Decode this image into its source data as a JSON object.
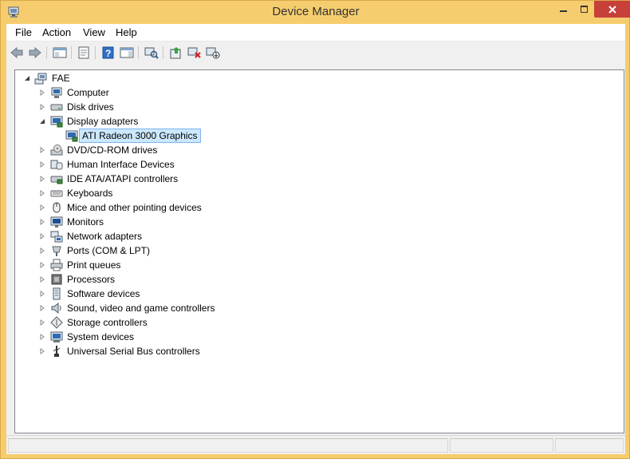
{
  "window": {
    "title": "Device Manager",
    "colors": {
      "frame": "#f6cd6e",
      "close": "#c7403a",
      "selection": "#cce8ff"
    }
  },
  "menu": [
    "File",
    "Action",
    "View",
    "Help"
  ],
  "toolbar": {
    "buttons": [
      "back-icon",
      "forward-icon",
      "show-hide-console-tree-icon",
      "properties-icon",
      "help-icon",
      "action-pane-icon",
      "scan-hardware-icon",
      "update-driver-icon",
      "uninstall-device-icon",
      "disable-device-icon"
    ]
  },
  "tree": {
    "root": "FAE",
    "categories": [
      {
        "label": "Computer",
        "icon": "computer-icon",
        "expanded": false
      },
      {
        "label": "Disk drives",
        "icon": "disk-drive-icon",
        "expanded": false
      },
      {
        "label": "Display adapters",
        "icon": "display-adapter-icon",
        "expanded": true,
        "children": [
          "ATI Radeon 3000 Graphics"
        ]
      },
      {
        "label": "DVD/CD-ROM drives",
        "icon": "dvd-drive-icon",
        "expanded": false
      },
      {
        "label": "Human Interface Devices",
        "icon": "hid-icon",
        "expanded": false
      },
      {
        "label": "IDE ATA/ATAPI controllers",
        "icon": "ide-controller-icon",
        "expanded": false
      },
      {
        "label": "Keyboards",
        "icon": "keyboard-icon",
        "expanded": false
      },
      {
        "label": "Mice and other pointing devices",
        "icon": "mouse-icon",
        "expanded": false
      },
      {
        "label": "Monitors",
        "icon": "monitor-icon",
        "expanded": false
      },
      {
        "label": "Network adapters",
        "icon": "network-adapter-icon",
        "expanded": false
      },
      {
        "label": "Ports (COM & LPT)",
        "icon": "port-icon",
        "expanded": false
      },
      {
        "label": "Print queues",
        "icon": "printer-icon",
        "expanded": false
      },
      {
        "label": "Processors",
        "icon": "processor-icon",
        "expanded": false
      },
      {
        "label": "Software devices",
        "icon": "software-device-icon",
        "expanded": false
      },
      {
        "label": "Sound, video and game controllers",
        "icon": "speaker-icon",
        "expanded": false
      },
      {
        "label": "Storage controllers",
        "icon": "storage-controller-icon",
        "expanded": false
      },
      {
        "label": "System devices",
        "icon": "system-device-icon",
        "expanded": false
      },
      {
        "label": "Universal Serial Bus controllers",
        "icon": "usb-icon",
        "expanded": false
      }
    ],
    "selected": "ATI Radeon 3000 Graphics"
  }
}
